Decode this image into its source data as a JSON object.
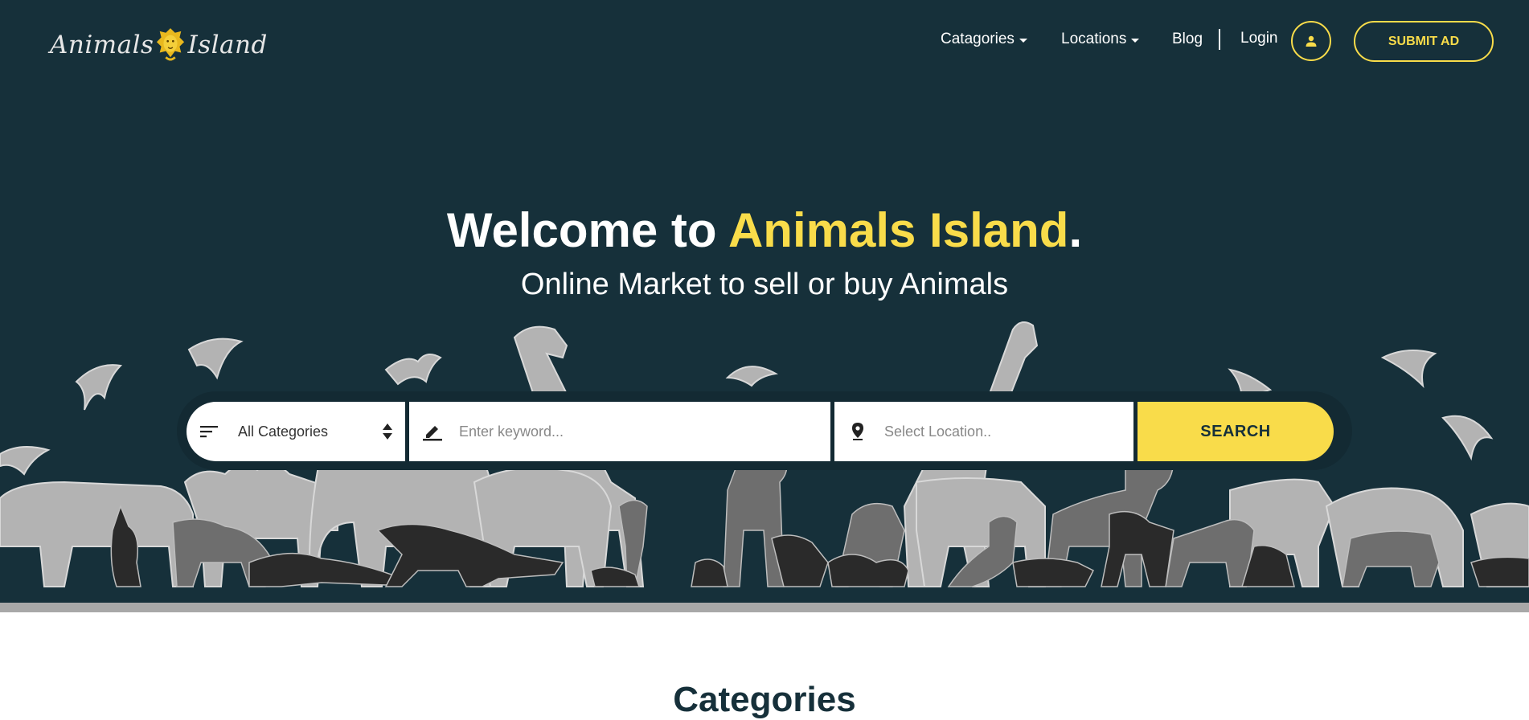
{
  "header": {
    "logo_text_left": "Animals",
    "logo_text_right": "Island",
    "nav": {
      "categories": "Catagories",
      "locations": "Locations",
      "blog": "Blog",
      "login": "Login"
    },
    "submit_ad": "SUBMIT AD"
  },
  "hero": {
    "title_prefix": "Welcome to ",
    "title_accent": "Animals Island",
    "title_suffix": ".",
    "subtitle": "Online Market to sell or buy Animals"
  },
  "search": {
    "category_value": "All Categories",
    "keyword_placeholder": "Enter keyword...",
    "location_placeholder": "Select Location..",
    "button_label": "SEARCH"
  },
  "section": {
    "categories_title": "Categories"
  },
  "colors": {
    "background": "#16303a",
    "accent": "#f9dc4a"
  },
  "icons": [
    "lion-logo-icon",
    "user-icon",
    "filter-lines-icon",
    "pencil-icon",
    "map-pin-icon",
    "sort-arrows-icon"
  ]
}
